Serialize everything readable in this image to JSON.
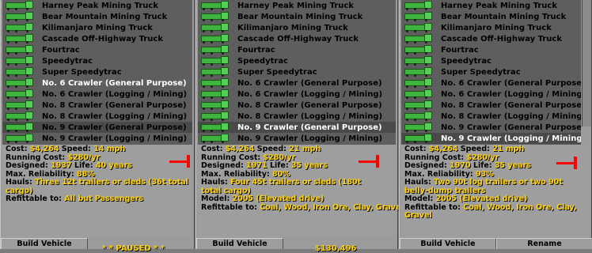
{
  "vehicles": [
    "Harney Peak Mining Truck",
    "Bear Mountain Mining Truck",
    "Kilimanjaro Mining Truck",
    "Cascade Off-Highway Truck",
    "Fourtrac",
    "Speedytrac",
    "Super Speedytrac",
    "No. 6 Crawler (General Purpose)",
    "No. 6 Crawler (Logging / Mining)",
    "No. 8 Crawler (General Purpose)",
    "No. 8 Crawler (Logging / Mining)",
    "No. 9 Crawler (General Purpose)",
    "No. 9 Crawler (Logging / Mining)"
  ],
  "labels": {
    "cost": "Cost:",
    "speed": "Speed:",
    "running_cost": "Running Cost:",
    "designed": "Designed:",
    "life": "Life:",
    "max_reliability": "Max. Reliability:",
    "hauls": "Hauls:",
    "model": "Model:",
    "refittable": "Refittable to:"
  },
  "panels": [
    {
      "selected_index": 11,
      "white_indices": [
        7
      ],
      "cost": "$4,264",
      "speed": "14 mph",
      "running_cost": "$280/yr",
      "designed": "1937",
      "life": "40 years",
      "max_reliability": "88%",
      "hauls": "Three 12t trailers or sleds (36t total cargo)",
      "refittable": "All but Passengers",
      "button_left": "Build Vehicle",
      "status": "* * PAUSED * *"
    },
    {
      "selected_index": 11,
      "white_indices": [
        11
      ],
      "cost": "$4,264",
      "speed": "21 mph",
      "running_cost": "$280/yr",
      "designed": "1971",
      "life": "35 years",
      "max_reliability": "80%",
      "hauls": "Four 45t trailers or sleds (180t total cargo)",
      "model": "2005 (Elevated drive)",
      "refittable": "Coal, Wood, Iron Ore, Clay, Gravel",
      "button_left": "Build Vehicle",
      "status": "$130,496"
    },
    {
      "selected_index": 12,
      "white_indices": [
        12
      ],
      "cost": "$4,264",
      "speed": "21 mph",
      "running_cost": "$280/yr",
      "designed": "1970",
      "life": "35 years",
      "max_reliability": "93%",
      "hauls": "Two 90t log trailers or two 90t belly-dump trailers",
      "model": "2005 (Elevated drive)",
      "refittable": "Coal, Wood, Iron Ore, Clay, Gravel",
      "button_left": "Build Vehicle",
      "button_right": "Rename"
    }
  ]
}
